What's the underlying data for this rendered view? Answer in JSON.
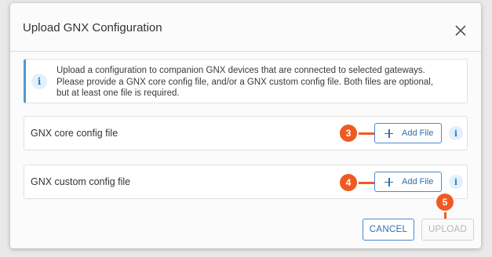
{
  "dialog": {
    "title": "Upload GNX Configuration",
    "close_icon": "close-icon"
  },
  "banner": {
    "icon": "info-icon",
    "icon_glyph": "i",
    "lines": [
      "Upload a configuration to companion GNX devices that are connected to selected gateways.",
      "Please provide a GNX core config file, and/or a GNX custom config file. Both files are optional,",
      "but at least one file is required."
    ]
  },
  "rows": [
    {
      "label": "GNX core config file",
      "button_label": "Add File",
      "info_glyph": "i",
      "callout": "3"
    },
    {
      "label": "GNX custom config file",
      "button_label": "Add File",
      "info_glyph": "i",
      "callout": "4"
    }
  ],
  "footer": {
    "cancel_label": "CANCEL",
    "upload_label": "UPLOAD",
    "upload_callout": "5"
  },
  "colors": {
    "accent": "#2f6fae",
    "callout": "#ef5a24",
    "banner_border": "#4f9ad4"
  }
}
